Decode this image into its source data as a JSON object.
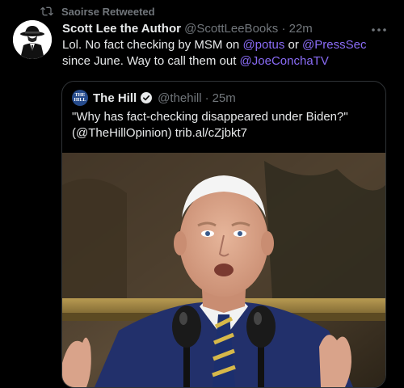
{
  "retweet": {
    "label": "Saoirse Retweeted"
  },
  "tweet": {
    "display_name": "Scott Lee the Author",
    "handle": "@ScottLeeBooks",
    "separator": "·",
    "time": "22m",
    "text_part1": "Lol. No fact checking by MSM on ",
    "mention1": "@potus",
    "text_part2": " or ",
    "mention2": "@PressSec",
    "text_part3": " since June. Way to call them out ",
    "mention3": "@JoeConchaTV"
  },
  "quote": {
    "avatar_text_line1": "THE",
    "avatar_text_line2": "HILL",
    "display_name": "The Hill",
    "handle": "@thehill",
    "separator": "·",
    "time": "25m",
    "text": "\"Why has fact-checking disappeared under Biden?\" (@TheHillOpinion) trib.al/cZjbkt7"
  },
  "colors": {
    "background": "#000000",
    "text": "#e7e9ea",
    "muted": "#71767b",
    "mention": "#8a6cf7",
    "verified": "#e7e9ea",
    "border": "#2f3336"
  },
  "icons": {
    "retweet": "retweet-icon",
    "more": "more-icon",
    "verified": "verified-badge-icon"
  }
}
